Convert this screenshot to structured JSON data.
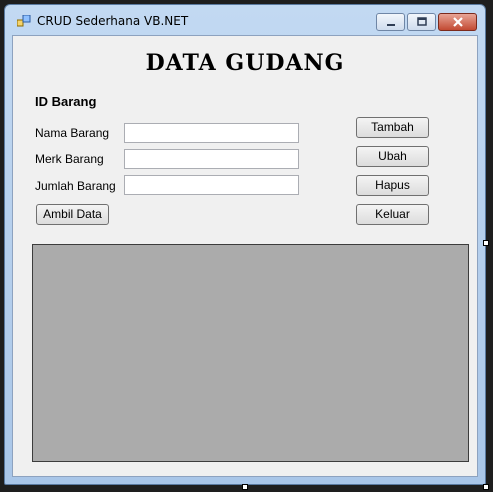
{
  "window": {
    "title": "CRUD Sederhana VB.NET"
  },
  "form": {
    "heading": "DATA GUDANG",
    "id_label": "ID Barang",
    "fields": [
      {
        "label": "Nama Barang",
        "value": ""
      },
      {
        "label": "Merk Barang",
        "value": ""
      },
      {
        "label": "Jumlah Barang",
        "value": ""
      }
    ],
    "buttons": {
      "tambah": "Tambah",
      "ubah": "Ubah",
      "hapus": "Hapus",
      "keluar": "Keluar",
      "ambil": "Ambil Data"
    }
  },
  "colors": {
    "grid_background": "#ababab",
    "form_background": "#f0f0f0"
  },
  "icons": {
    "app": "app-icon",
    "minimize": "minimize-icon",
    "maximize": "maximize-icon",
    "close": "close-icon"
  }
}
